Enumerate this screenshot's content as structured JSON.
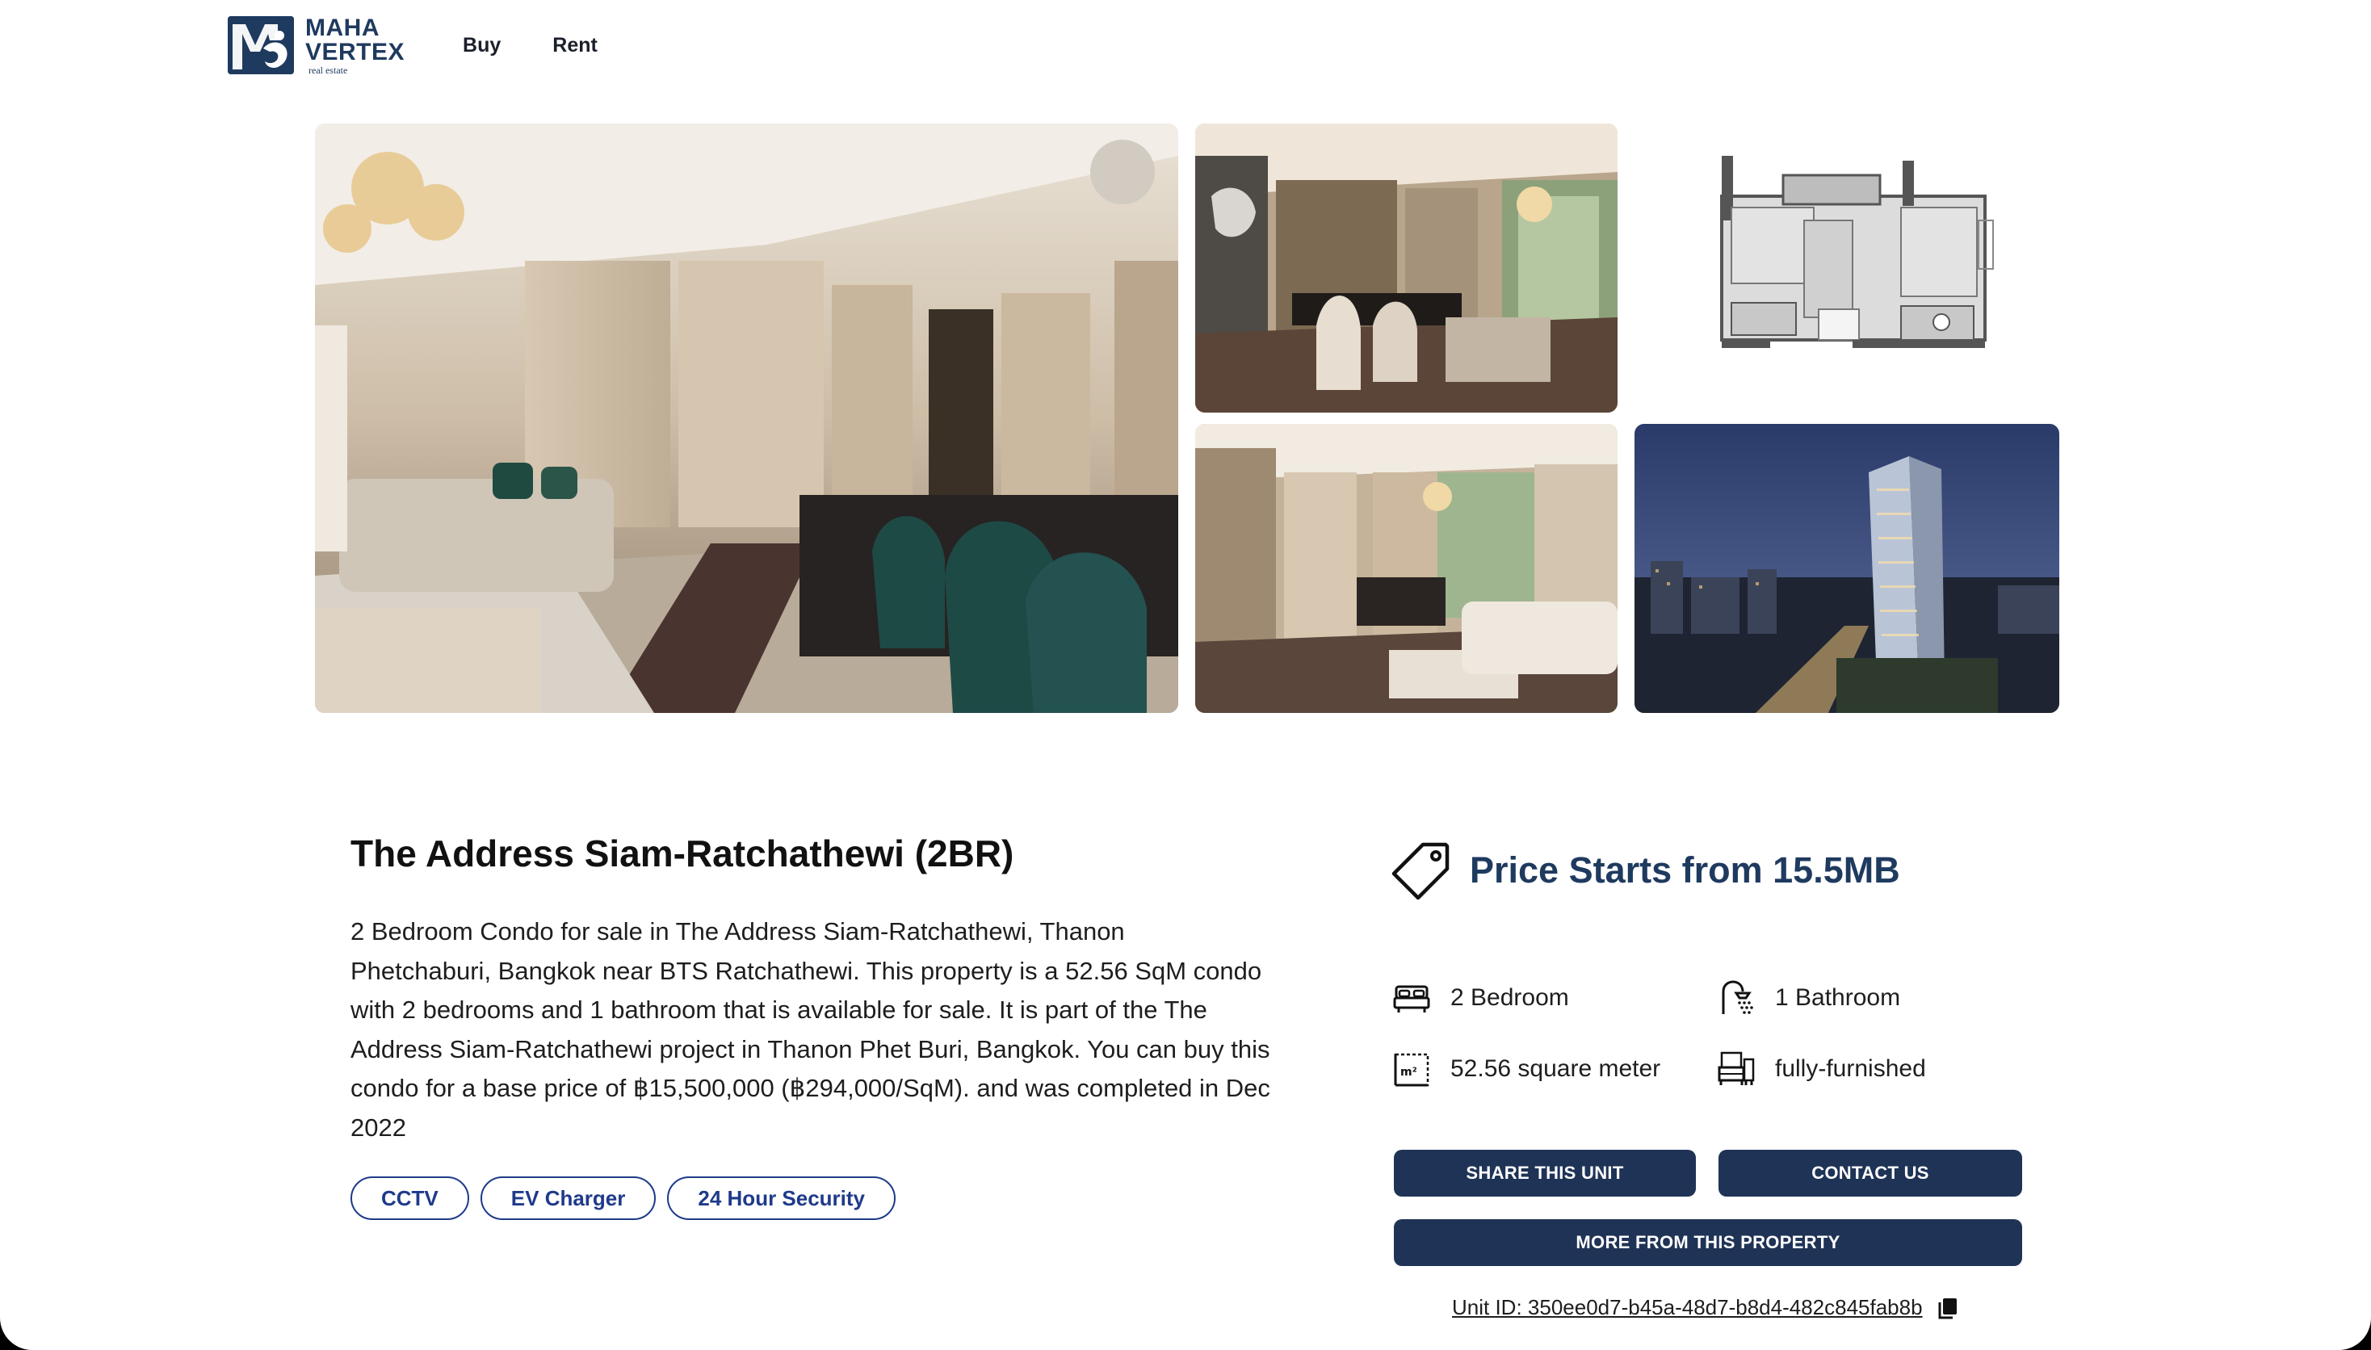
{
  "brand": {
    "line1": "MAHA",
    "line2": "VERTEX",
    "line3": "real estate",
    "color": "#1f3a5f"
  },
  "nav": {
    "items": [
      {
        "label": "Buy"
      },
      {
        "label": "Rent"
      }
    ]
  },
  "gallery": {
    "images": [
      {
        "icon": "living-room-photo"
      },
      {
        "icon": "dining-room-photo"
      },
      {
        "icon": "floor-plan-image"
      },
      {
        "icon": "living-room-photo-2"
      },
      {
        "icon": "building-exterior-photo"
      }
    ]
  },
  "listing": {
    "title": "The Address Siam-Ratchathewi (2BR)",
    "description": "2 Bedroom Condo for sale in The Address Siam-Ratchathewi, Thanon Phetchaburi, Bangkok near BTS Ratchathewi. This property is a 52.56 SqM condo with 2 bedrooms and 1 bathroom that is available for sale. It is part of the The Address Siam-Ratchathewi project in Thanon Phet Buri, Bangkok. You can buy this condo for a base price of ฿15,500,000 (฿294,000/SqM). and was completed in Dec 2022",
    "tags": [
      {
        "label": "CCTV"
      },
      {
        "label": "EV Charger"
      },
      {
        "label": "24 Hour Security"
      }
    ]
  },
  "panel": {
    "price": "Price Starts from 15.5MB",
    "features": {
      "bedroom": "2 Bedroom",
      "bathroom": "1 Bathroom",
      "area": "52.56 square meter",
      "furnishing": "fully-furnished",
      "area_icon_text": "m²"
    },
    "buttons": {
      "share": "SHARE THIS UNIT",
      "contact": "CONTACT US",
      "more": "MORE FROM THIS PROPERTY"
    },
    "unit_id": "Unit ID: 350ee0d7-b45a-48d7-b8d4-482c845fab8b"
  },
  "colors": {
    "accent": "#1f3356",
    "tag_border": "#1f3a8a",
    "price": "#1f3a5f"
  }
}
